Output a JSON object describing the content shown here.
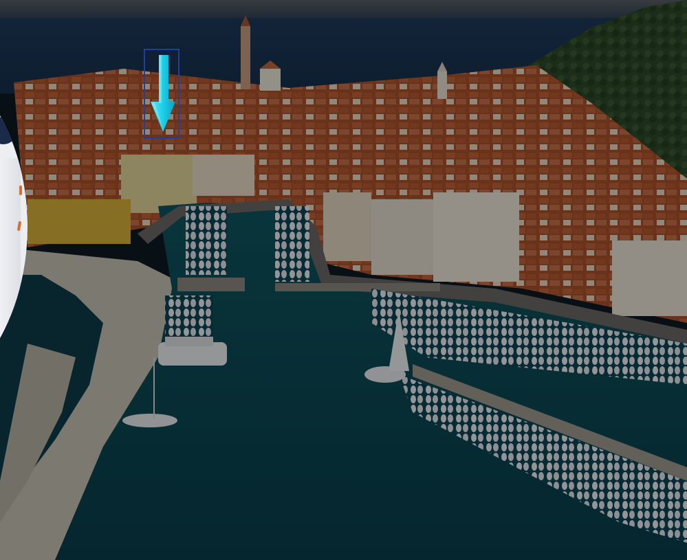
{
  "scene": {
    "kind": "aerial-photo",
    "subject": "harbor-town",
    "dimmed": true
  },
  "hint": {
    "icon": "down-arrow-icon",
    "arrow_color": "#1ccfe8",
    "box_color": "#1f3f9e"
  },
  "side_panel": {
    "icon": "partial-disc",
    "accent_color": "#e06a2c",
    "navy_color": "#1c2a4a"
  }
}
